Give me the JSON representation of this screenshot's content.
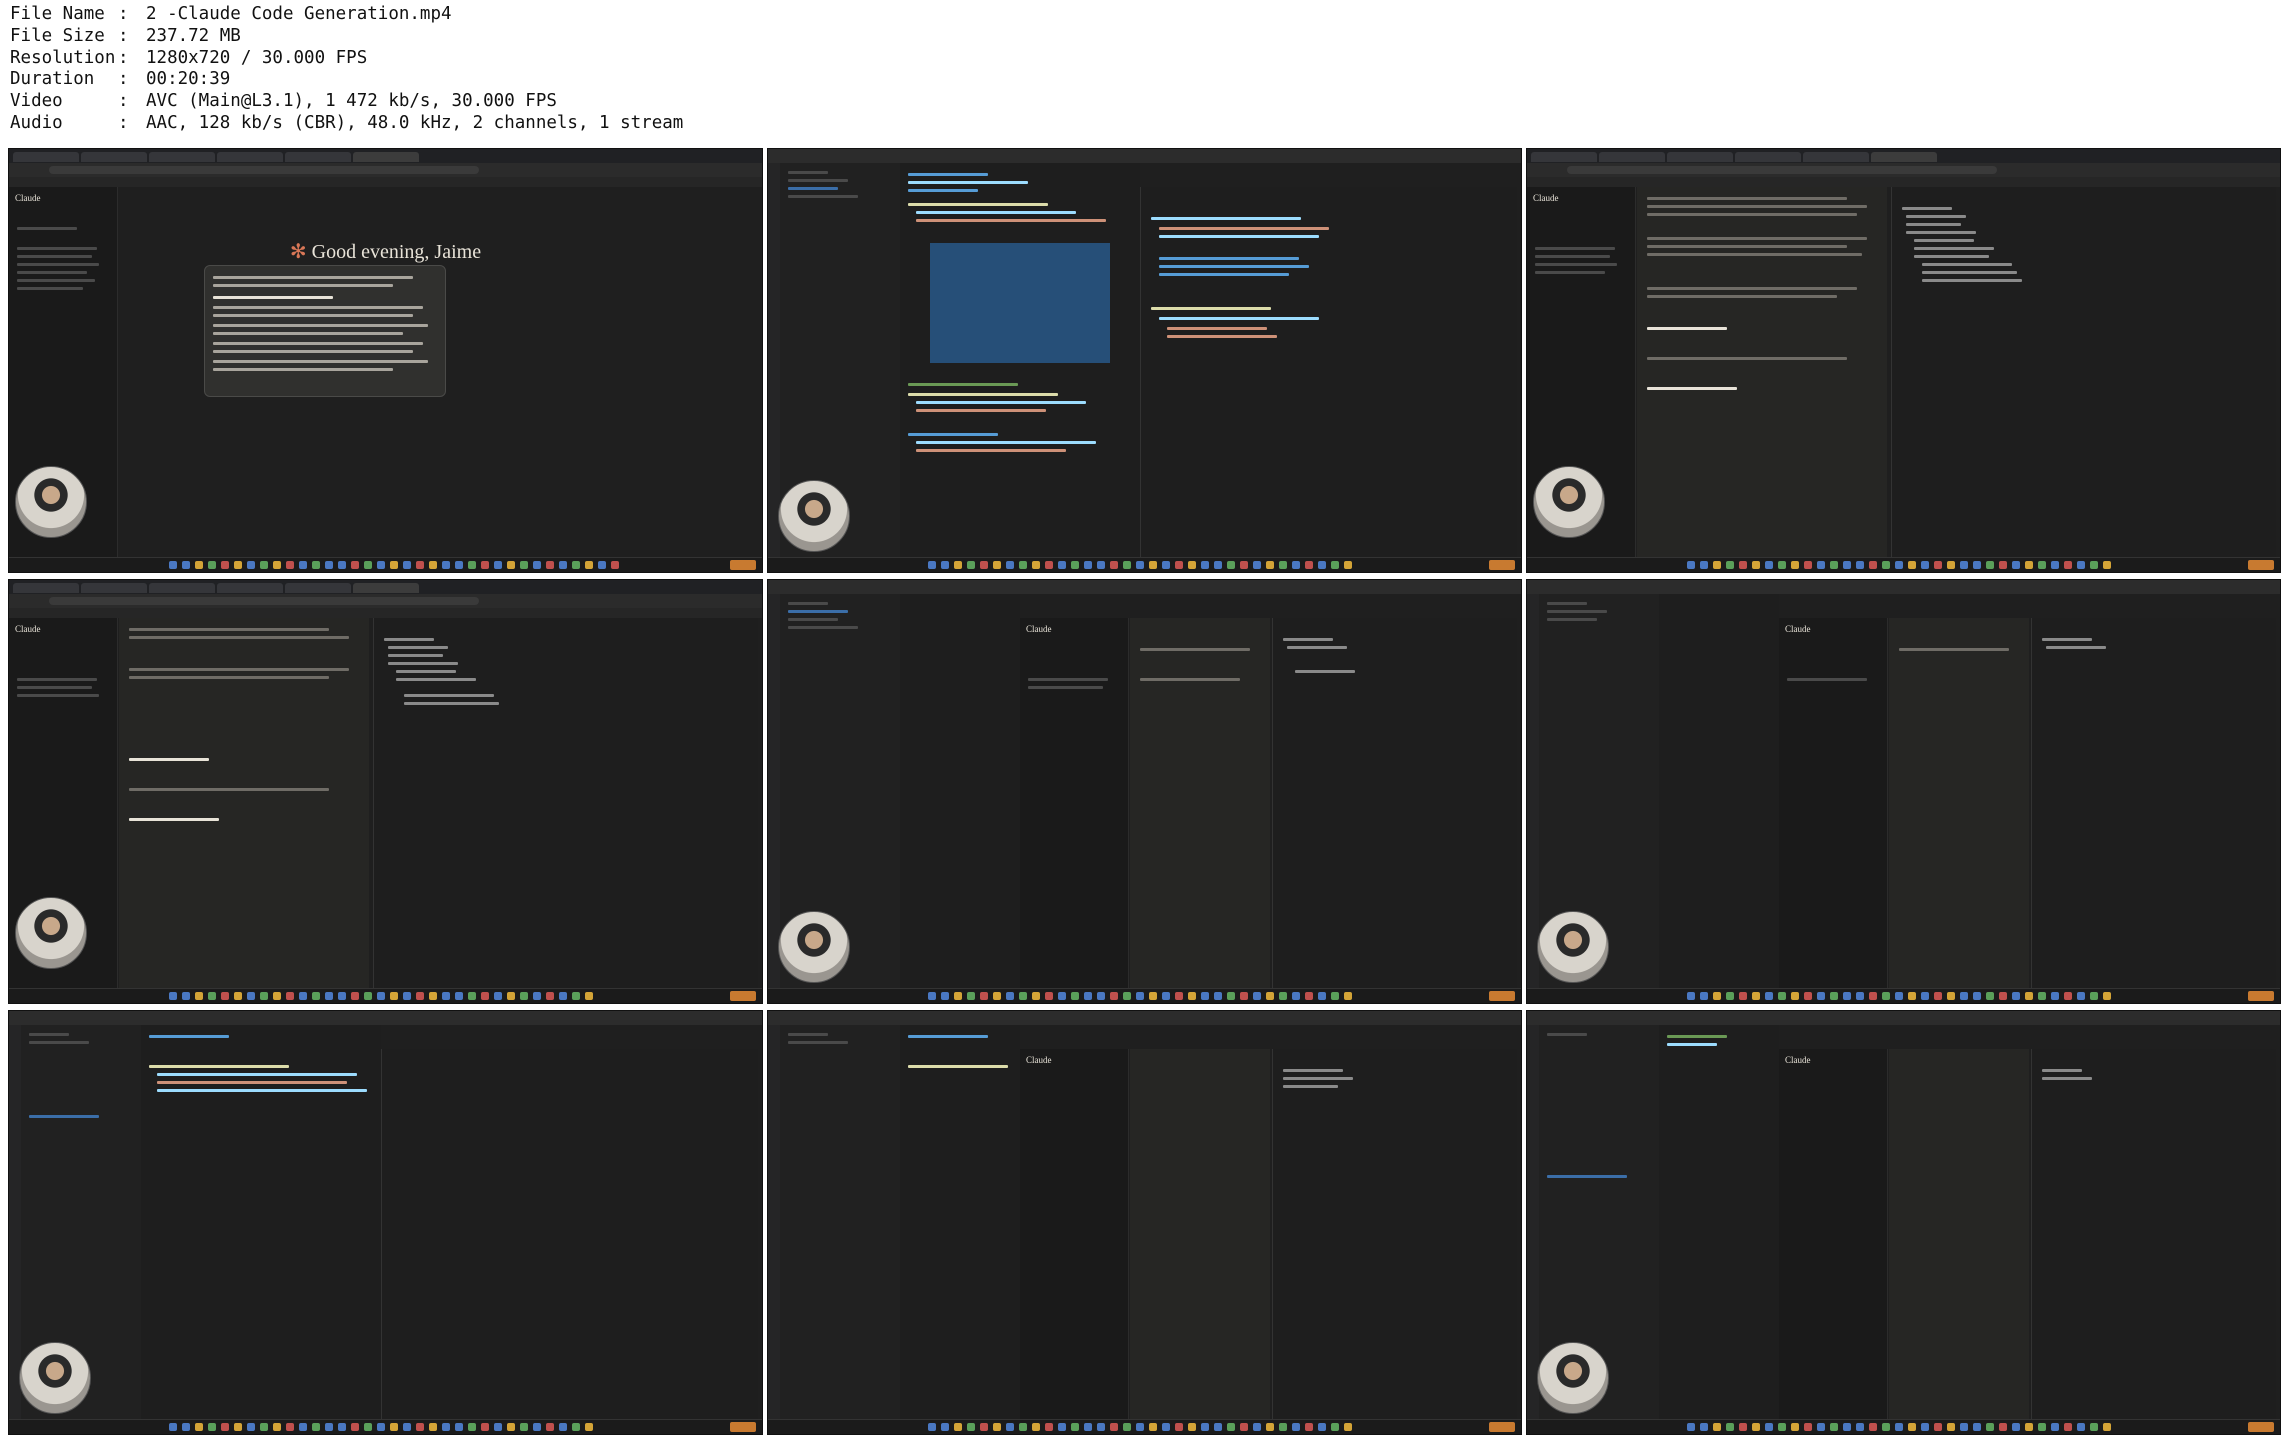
{
  "file_info": [
    {
      "key": "File Name",
      "value": "2 -Claude Code Generation.mp4"
    },
    {
      "key": "File Size",
      "value": "237.72 MB"
    },
    {
      "key": "Resolution",
      "value": "1280x720 / 30.000 FPS"
    },
    {
      "key": "Duration",
      "value": "00:20:39"
    },
    {
      "key": "Video",
      "value": "AVC (Main@L3.1), 1 472 kb/s, 30.000 FPS"
    },
    {
      "key": "Audio",
      "value": "AAC, 128 kb/s (CBR), 48.0 kHz, 2 channels, 1 stream"
    }
  ],
  "separator": ":",
  "thumbnail_1": {
    "greeting": "Good evening, Jaime",
    "greeting_icon": "sparkle-icon"
  },
  "colors": {
    "accent": "#d97757",
    "editor_bg": "#1e1e1e",
    "panel_bg": "#262624"
  }
}
